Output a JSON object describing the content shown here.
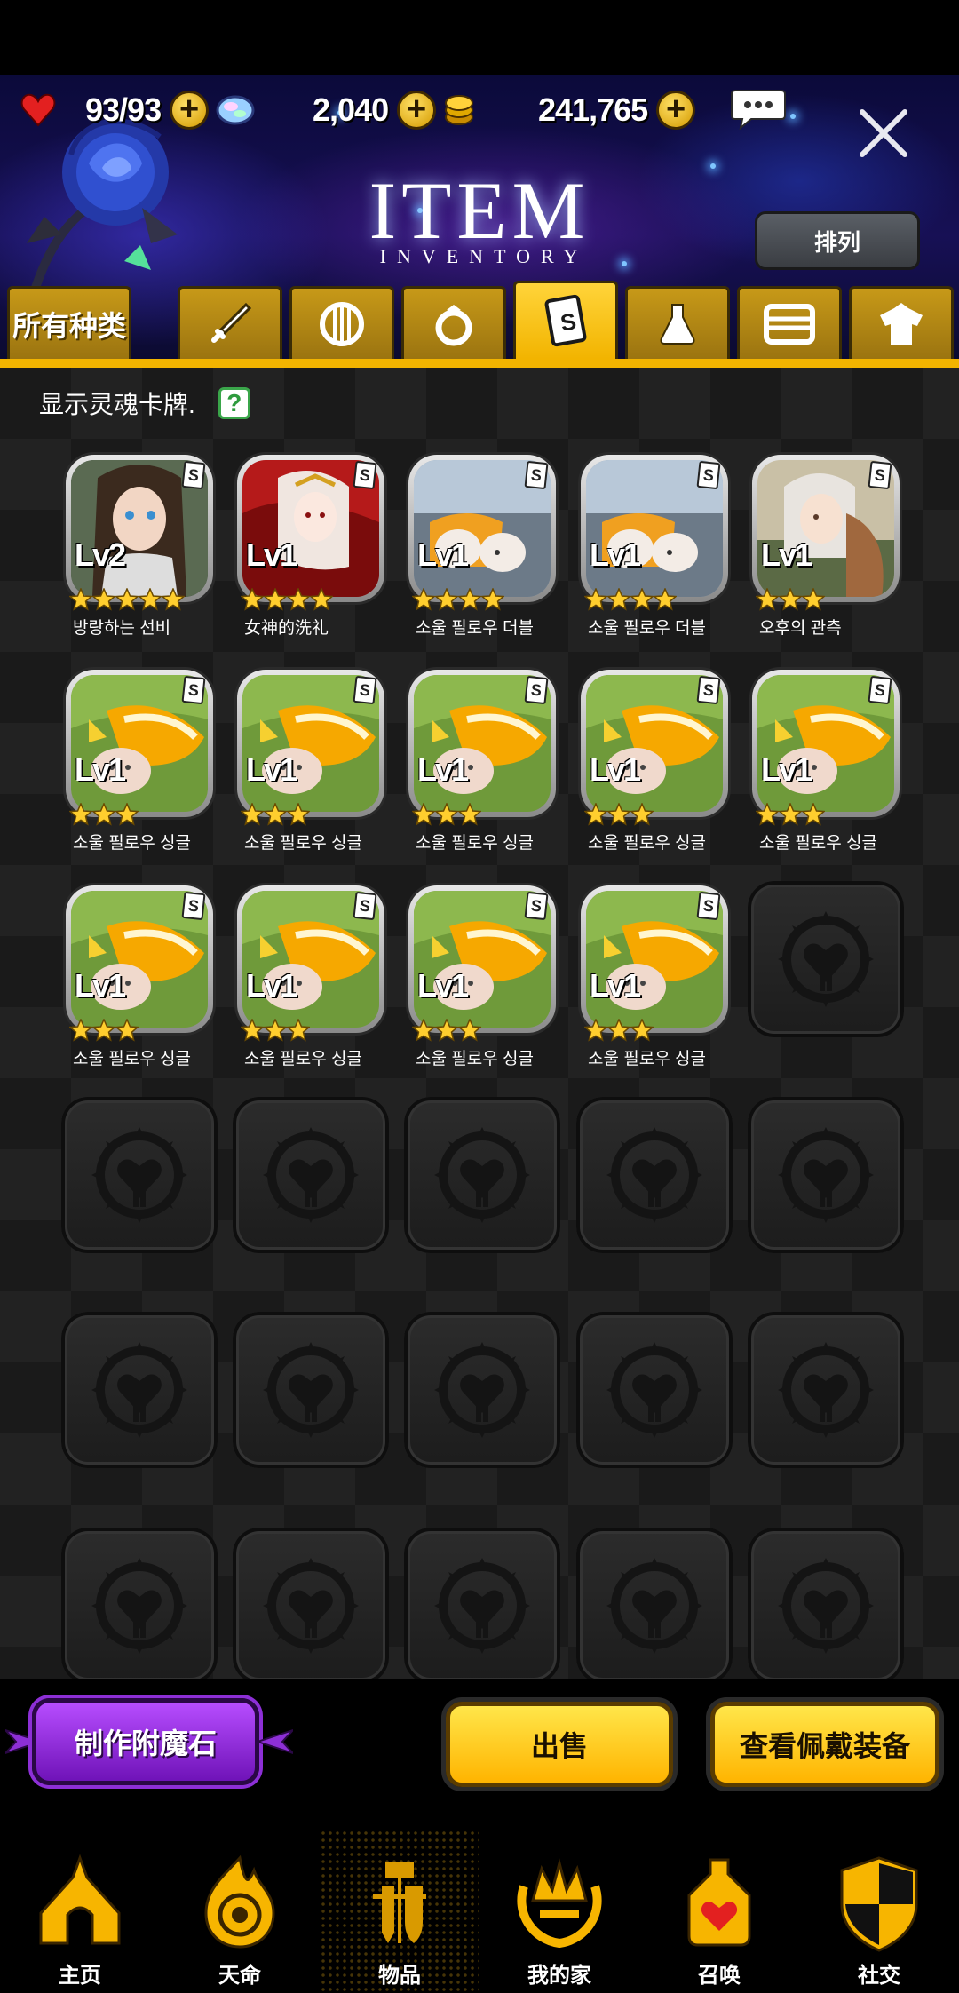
{
  "header": {
    "resources": [
      {
        "name": "heart",
        "value": "93/93"
      },
      {
        "name": "crystal",
        "value": "2,040"
      },
      {
        "name": "gold",
        "value": "241,765"
      }
    ],
    "title": "ITEM",
    "subtitle": "INVENTORY",
    "sort_label": "排列"
  },
  "tabs": [
    {
      "label": "所有种类",
      "icon": "all"
    },
    {
      "label": "",
      "icon": "sword-icon"
    },
    {
      "label": "",
      "icon": "shield-icon"
    },
    {
      "label": "",
      "icon": "ring-icon"
    },
    {
      "label": "",
      "icon": "soul-card-icon",
      "active": true
    },
    {
      "label": "",
      "icon": "potion-icon"
    },
    {
      "label": "",
      "icon": "card-icon"
    },
    {
      "label": "",
      "icon": "costume-icon"
    }
  ],
  "main": {
    "show_soul_cards_label": "显示灵魂卡牌.",
    "help_label": "?",
    "items": [
      {
        "level": "Lv2",
        "stars": 5,
        "name": "방랑하는 선비",
        "art": "girl"
      },
      {
        "level": "Lv1",
        "stars": 4,
        "name": "女神的洗礼",
        "art": "goddess"
      },
      {
        "level": "Lv1",
        "stars": 4,
        "name": "소울 필로우 더블",
        "art": "double"
      },
      {
        "level": "Lv1",
        "stars": 4,
        "name": "소울 필로우 더블",
        "art": "double"
      },
      {
        "level": "Lv1",
        "stars": 3,
        "name": "오후의 관측",
        "art": "observer"
      },
      {
        "level": "Lv1",
        "stars": 3,
        "name": "소울 필로우 싱글",
        "art": "single"
      },
      {
        "level": "Lv1",
        "stars": 3,
        "name": "소울 필로우 싱글",
        "art": "single"
      },
      {
        "level": "Lv1",
        "stars": 3,
        "name": "소울 필로우 싱글",
        "art": "single"
      },
      {
        "level": "Lv1",
        "stars": 3,
        "name": "소울 필로우 싱글",
        "art": "single"
      },
      {
        "level": "Lv1",
        "stars": 3,
        "name": "소울 필로우 싱글",
        "art": "single"
      },
      {
        "level": "Lv1",
        "stars": 3,
        "name": "소울 필로우 싱글",
        "art": "single"
      },
      {
        "level": "Lv1",
        "stars": 3,
        "name": "소울 필로우 싱글",
        "art": "single"
      },
      {
        "level": "Lv1",
        "stars": 3,
        "name": "소울 필로우 싱글",
        "art": "single"
      },
      {
        "level": "Lv1",
        "stars": 3,
        "name": "소울 필로우 싱글",
        "art": "single"
      }
    ],
    "badge_label": "S"
  },
  "actions": {
    "craft_label": "制作附魔石",
    "sell_label": "出售",
    "view_equipped_label": "查看佩戴装备"
  },
  "nav": [
    {
      "label": "主页",
      "icon": "home-icon"
    },
    {
      "label": "天命",
      "icon": "fate-icon"
    },
    {
      "label": "物品",
      "icon": "items-icon",
      "active": true
    },
    {
      "label": "我的家",
      "icon": "my-home-icon"
    },
    {
      "label": "召唤",
      "icon": "summon-icon"
    },
    {
      "label": "社交",
      "icon": "social-icon"
    }
  ],
  "colors": {
    "accent": "#f2b400",
    "purple": "#8d2fd6",
    "background": "#1a1a1a"
  }
}
